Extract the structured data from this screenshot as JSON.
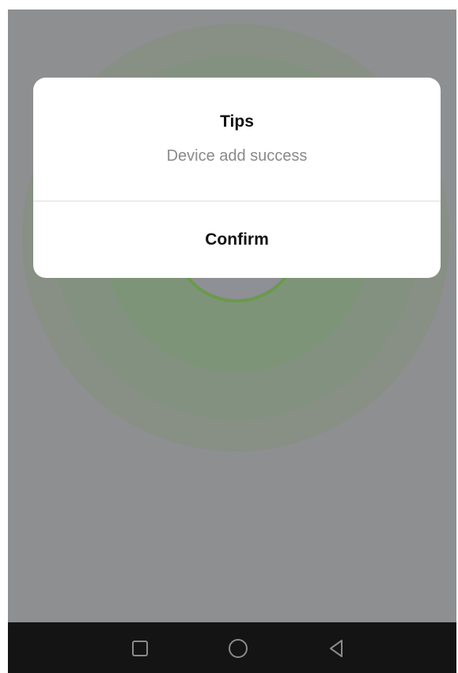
{
  "dialog": {
    "title": "Tips",
    "message": "Device add success",
    "confirm_label": "Confirm"
  },
  "navbar": {
    "icons": [
      "recent-apps-icon",
      "home-icon",
      "back-icon"
    ]
  },
  "colors": {
    "overlay": "#8e8f91",
    "ripple": "#7e9479",
    "scan_ring": "#6a9a4a",
    "dialog_background": "#ffffff",
    "navbar": "#141414"
  }
}
